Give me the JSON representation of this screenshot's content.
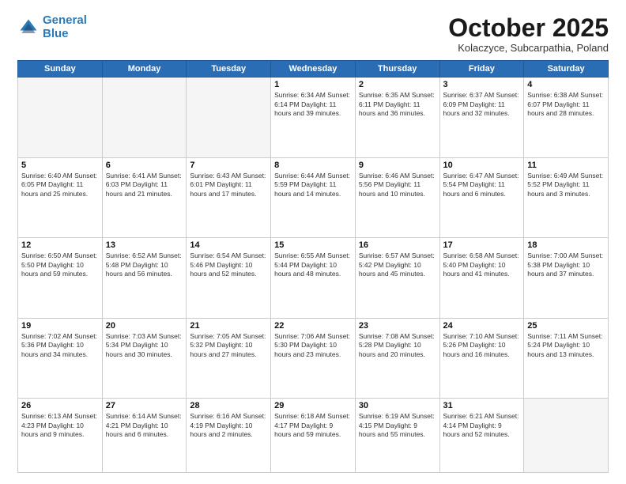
{
  "header": {
    "logo_line1": "General",
    "logo_line2": "Blue",
    "month": "October 2025",
    "location": "Kolaczyce, Subcarpathia, Poland"
  },
  "days_of_week": [
    "Sunday",
    "Monday",
    "Tuesday",
    "Wednesday",
    "Thursday",
    "Friday",
    "Saturday"
  ],
  "weeks": [
    [
      {
        "num": "",
        "info": ""
      },
      {
        "num": "",
        "info": ""
      },
      {
        "num": "",
        "info": ""
      },
      {
        "num": "1",
        "info": "Sunrise: 6:34 AM\nSunset: 6:14 PM\nDaylight: 11 hours\nand 39 minutes."
      },
      {
        "num": "2",
        "info": "Sunrise: 6:35 AM\nSunset: 6:11 PM\nDaylight: 11 hours\nand 36 minutes."
      },
      {
        "num": "3",
        "info": "Sunrise: 6:37 AM\nSunset: 6:09 PM\nDaylight: 11 hours\nand 32 minutes."
      },
      {
        "num": "4",
        "info": "Sunrise: 6:38 AM\nSunset: 6:07 PM\nDaylight: 11 hours\nand 28 minutes."
      }
    ],
    [
      {
        "num": "5",
        "info": "Sunrise: 6:40 AM\nSunset: 6:05 PM\nDaylight: 11 hours\nand 25 minutes."
      },
      {
        "num": "6",
        "info": "Sunrise: 6:41 AM\nSunset: 6:03 PM\nDaylight: 11 hours\nand 21 minutes."
      },
      {
        "num": "7",
        "info": "Sunrise: 6:43 AM\nSunset: 6:01 PM\nDaylight: 11 hours\nand 17 minutes."
      },
      {
        "num": "8",
        "info": "Sunrise: 6:44 AM\nSunset: 5:59 PM\nDaylight: 11 hours\nand 14 minutes."
      },
      {
        "num": "9",
        "info": "Sunrise: 6:46 AM\nSunset: 5:56 PM\nDaylight: 11 hours\nand 10 minutes."
      },
      {
        "num": "10",
        "info": "Sunrise: 6:47 AM\nSunset: 5:54 PM\nDaylight: 11 hours\nand 6 minutes."
      },
      {
        "num": "11",
        "info": "Sunrise: 6:49 AM\nSunset: 5:52 PM\nDaylight: 11 hours\nand 3 minutes."
      }
    ],
    [
      {
        "num": "12",
        "info": "Sunrise: 6:50 AM\nSunset: 5:50 PM\nDaylight: 10 hours\nand 59 minutes."
      },
      {
        "num": "13",
        "info": "Sunrise: 6:52 AM\nSunset: 5:48 PM\nDaylight: 10 hours\nand 56 minutes."
      },
      {
        "num": "14",
        "info": "Sunrise: 6:54 AM\nSunset: 5:46 PM\nDaylight: 10 hours\nand 52 minutes."
      },
      {
        "num": "15",
        "info": "Sunrise: 6:55 AM\nSunset: 5:44 PM\nDaylight: 10 hours\nand 48 minutes."
      },
      {
        "num": "16",
        "info": "Sunrise: 6:57 AM\nSunset: 5:42 PM\nDaylight: 10 hours\nand 45 minutes."
      },
      {
        "num": "17",
        "info": "Sunrise: 6:58 AM\nSunset: 5:40 PM\nDaylight: 10 hours\nand 41 minutes."
      },
      {
        "num": "18",
        "info": "Sunrise: 7:00 AM\nSunset: 5:38 PM\nDaylight: 10 hours\nand 37 minutes."
      }
    ],
    [
      {
        "num": "19",
        "info": "Sunrise: 7:02 AM\nSunset: 5:36 PM\nDaylight: 10 hours\nand 34 minutes."
      },
      {
        "num": "20",
        "info": "Sunrise: 7:03 AM\nSunset: 5:34 PM\nDaylight: 10 hours\nand 30 minutes."
      },
      {
        "num": "21",
        "info": "Sunrise: 7:05 AM\nSunset: 5:32 PM\nDaylight: 10 hours\nand 27 minutes."
      },
      {
        "num": "22",
        "info": "Sunrise: 7:06 AM\nSunset: 5:30 PM\nDaylight: 10 hours\nand 23 minutes."
      },
      {
        "num": "23",
        "info": "Sunrise: 7:08 AM\nSunset: 5:28 PM\nDaylight: 10 hours\nand 20 minutes."
      },
      {
        "num": "24",
        "info": "Sunrise: 7:10 AM\nSunset: 5:26 PM\nDaylight: 10 hours\nand 16 minutes."
      },
      {
        "num": "25",
        "info": "Sunrise: 7:11 AM\nSunset: 5:24 PM\nDaylight: 10 hours\nand 13 minutes."
      }
    ],
    [
      {
        "num": "26",
        "info": "Sunrise: 6:13 AM\nSunset: 4:23 PM\nDaylight: 10 hours\nand 9 minutes."
      },
      {
        "num": "27",
        "info": "Sunrise: 6:14 AM\nSunset: 4:21 PM\nDaylight: 10 hours\nand 6 minutes."
      },
      {
        "num": "28",
        "info": "Sunrise: 6:16 AM\nSunset: 4:19 PM\nDaylight: 10 hours\nand 2 minutes."
      },
      {
        "num": "29",
        "info": "Sunrise: 6:18 AM\nSunset: 4:17 PM\nDaylight: 9 hours\nand 59 minutes."
      },
      {
        "num": "30",
        "info": "Sunrise: 6:19 AM\nSunset: 4:15 PM\nDaylight: 9 hours\nand 55 minutes."
      },
      {
        "num": "31",
        "info": "Sunrise: 6:21 AM\nSunset: 4:14 PM\nDaylight: 9 hours\nand 52 minutes."
      },
      {
        "num": "",
        "info": ""
      }
    ]
  ]
}
